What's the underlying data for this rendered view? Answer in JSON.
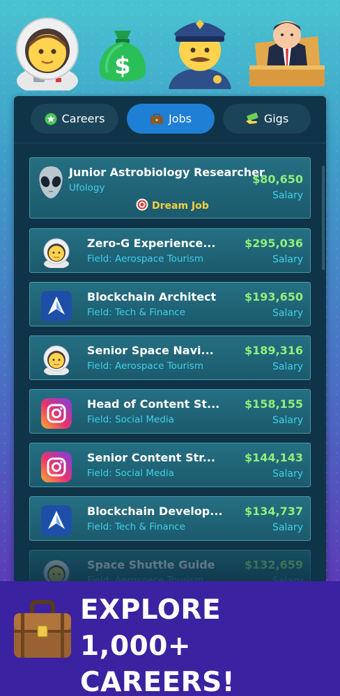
{
  "tabs": [
    {
      "label": "Careers",
      "icon": "star-badge-icon",
      "active": false
    },
    {
      "label": "Jobs",
      "icon": "briefcase-icon",
      "active": true
    },
    {
      "label": "Gigs",
      "icon": "money-hand-icon",
      "active": false
    }
  ],
  "jobs": [
    {
      "title": "Junior Astrobiology Researcher",
      "field": "Ufology",
      "salary": "$80,650",
      "salary_label": "Salary",
      "icon": "alien-icon",
      "badge": "Dream Job"
    },
    {
      "title": "Zero-G Experience...",
      "field": "Field: Aerospace Tourism",
      "salary": "$295,036",
      "salary_label": "Salary",
      "icon": "astronaut-icon"
    },
    {
      "title": "Blockchain Architect",
      "field": "Field: Tech & Finance",
      "salary": "$193,650",
      "salary_label": "Salary",
      "icon": "blockchain-app-icon"
    },
    {
      "title": "Senior Space Navi...",
      "field": "Field: Aerospace Tourism",
      "salary": "$189,316",
      "salary_label": "Salary",
      "icon": "astronaut-icon"
    },
    {
      "title": "Head of Content St...",
      "field": "Field: Social Media",
      "salary": "$158,155",
      "salary_label": "Salary",
      "icon": "camera-app-icon"
    },
    {
      "title": "Senior Content Str...",
      "field": "Field: Social Media",
      "salary": "$144,143",
      "salary_label": "Salary",
      "icon": "camera-app-icon"
    },
    {
      "title": "Blockchain Develop...",
      "field": "Field: Tech & Finance",
      "salary": "$134,737",
      "salary_label": "Salary",
      "icon": "blockchain-app-icon"
    },
    {
      "title": "Space Shuttle Guide",
      "field": "Field: Aerospace Tourism",
      "salary": "$132,659",
      "salary_label": "Salary",
      "icon": "astronaut-icon"
    }
  ],
  "banner": {
    "line1": "EXPLORE 1,000+",
    "line2": "CAREERS!",
    "icon": "briefcase-icon"
  },
  "hero_icons": [
    "astronaut-icon",
    "money-bag-icon",
    "police-officer-icon",
    "judge-icon"
  ],
  "colors": {
    "accent": "#1f7fd4",
    "salary": "#8ef07a",
    "field": "#3fd0e8",
    "dream": "#f4d03f",
    "banner": "#3b22a0"
  }
}
